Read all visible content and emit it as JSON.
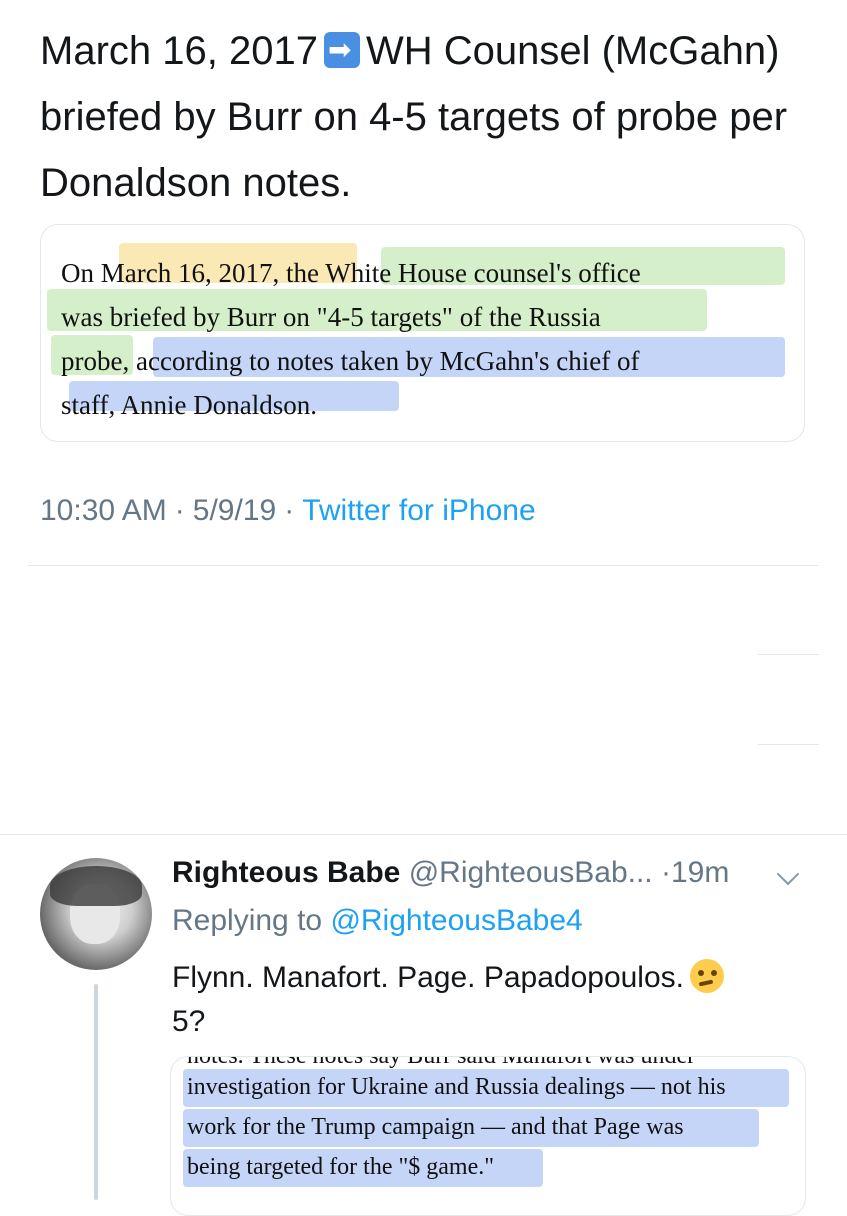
{
  "tweet": {
    "text_part1": "March 16, 2017",
    "text_part2": "WH Counsel (McGahn) briefed by Burr on 4-5 targets of probe per Donaldson notes.",
    "arrow_icon": "right-arrow-icon",
    "quote_lines": [
      "On March 16, 2017, the White House counsel's office",
      "was briefed by Burr on \"4-5 targets\" of the Russia",
      "probe, according to notes taken by McGahn's chief of",
      "staff, Annie Donaldson."
    ],
    "time": "10:30 AM",
    "date": "5/9/19",
    "source": "Twitter for iPhone"
  },
  "reply": {
    "name": "Righteous Babe",
    "handle": "@RighteousBab...",
    "time": "19m",
    "replying_label": "Replying to",
    "replying_to": "@RighteousBabe4",
    "text_line1": "Flynn. Manafort. Page. Papadopoulos.",
    "text_line2": "5?",
    "emoji_icon": "thinking-face-icon",
    "media_cut_line": "notes. These notes say Burr said Manafort was under",
    "media_lines": [
      "investigation for Ukraine and Russia dealings — not his",
      "work for the Trump campaign — and that Page was",
      "being targeted for the \"$ game.\""
    ]
  },
  "colors": {
    "link": "#1da1f2",
    "muted": "#657786",
    "highlight_yellow": "#f6cf5a",
    "highlight_green": "#9fdc88",
    "highlight_blue": "#7ea2f0"
  }
}
